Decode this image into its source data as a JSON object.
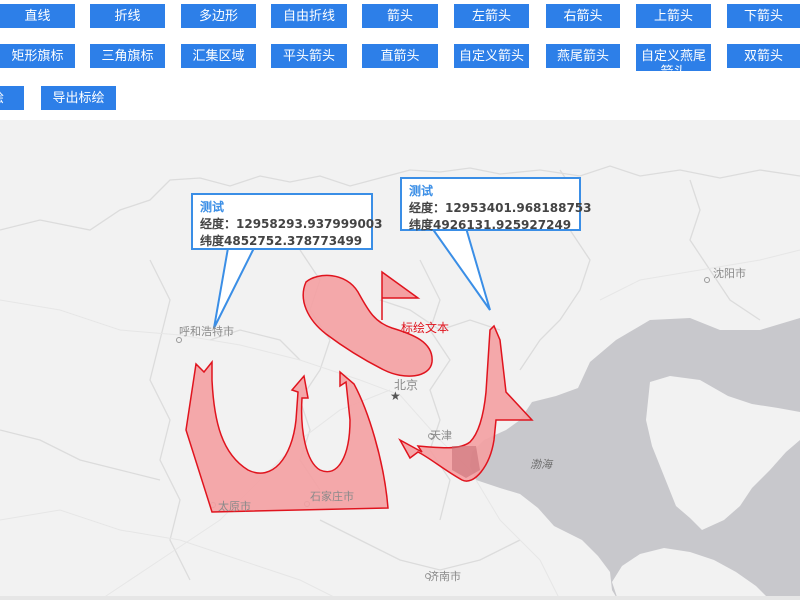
{
  "toolbar": {
    "row1": [
      "直线",
      "折线",
      "多边形",
      "自由折线",
      "箭头",
      "左箭头",
      "右箭头",
      "上箭头",
      "下箭头"
    ],
    "row2": [
      "矩形旗标",
      "三角旗标",
      "汇集区域",
      "平头箭头",
      "直箭头",
      "自定义箭头",
      "燕尾箭头",
      "自定义燕尾箭头",
      "双箭头"
    ],
    "row3": [
      "绘",
      "导出标绘"
    ]
  },
  "map": {
    "cities": {
      "huhehaote": "呼和浩特市",
      "beijing": "北京",
      "tianjin": "天津",
      "shenyang": "沈阳市",
      "taiyuan": "太原市",
      "shijiazhuang": "石家庄市",
      "jinan": "济南市"
    },
    "sea": "渤海",
    "annotation_text": "标绘文本",
    "popups": [
      {
        "title": "测试",
        "lon_line": "经度：12958293.937999003",
        "lat_line": "纬度4852752.378773499"
      },
      {
        "title": "测试",
        "lon_line": "经度：12953401.968188753",
        "lat_line": "纬度4926131.925927249"
      }
    ],
    "colors": {
      "plot_fill": "#f4a0a2",
      "plot_stroke": "#e0141e",
      "popup_border": "#3a8ee6",
      "water": "#c8c8cc"
    }
  }
}
